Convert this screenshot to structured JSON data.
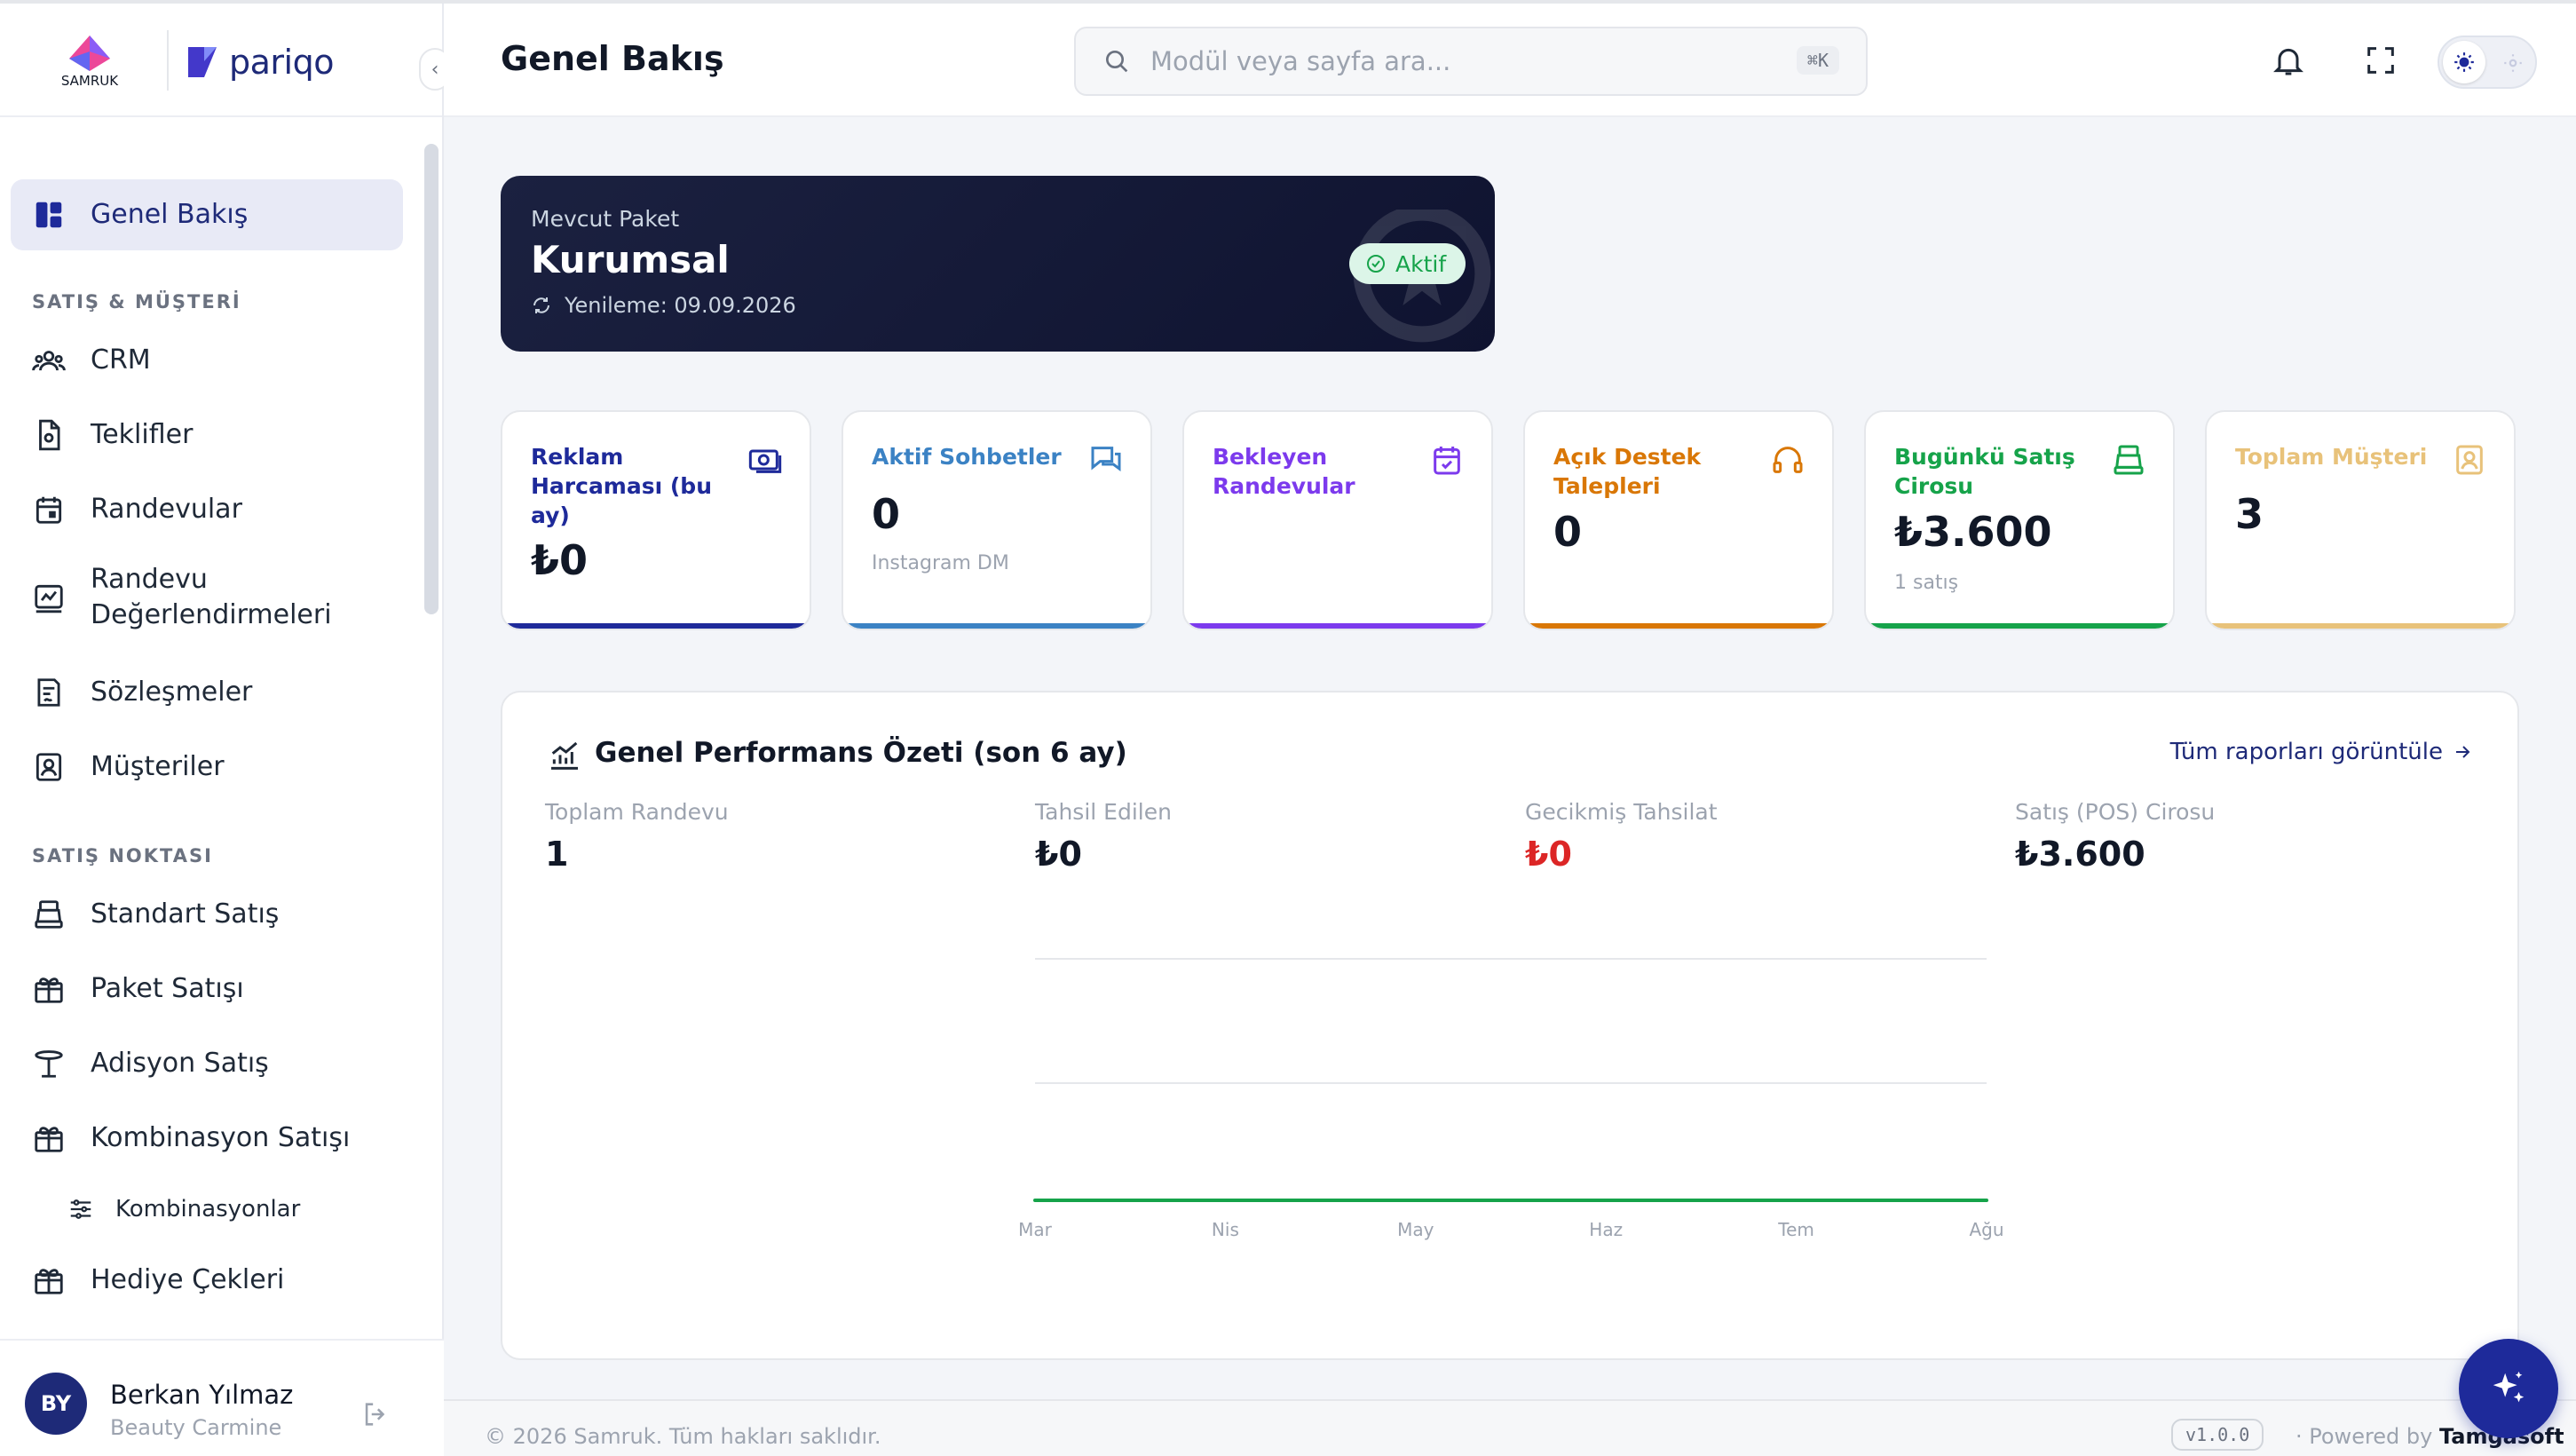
{
  "brand": {
    "left_logo_text": "SAMRUK",
    "right_logo_text": "pariqo"
  },
  "header": {
    "title": "Genel Bakış",
    "search_placeholder": "Modül veya sayfa ara...",
    "search_shortcut": "⌘K"
  },
  "sidebar": {
    "active": "Genel Bakış",
    "sections": [
      {
        "label": "",
        "items": [
          "Genel Bakış"
        ]
      },
      {
        "label": "SATIŞ & MÜŞTERİ",
        "items": [
          "CRM",
          "Teklifler",
          "Randevular",
          "Randevu Değerlendirmeleri",
          "Sözleşmeler",
          "Müşteriler"
        ]
      },
      {
        "label": "SATIŞ NOKTASI",
        "items": [
          "Standart Satış",
          "Paket Satışı",
          "Adisyon Satış",
          "Kombinasyon Satışı"
        ],
        "subitems": [
          "Kombinasyonlar"
        ],
        "more": [
          "Hediye Çekleri"
        ]
      }
    ],
    "labels": {
      "overview": "Genel Bakış",
      "sec_sales": "SATIŞ & MÜŞTERİ",
      "crm": "CRM",
      "offers": "Teklifler",
      "appointments": "Randevular",
      "reviews": "Randevu Değerlendirmeleri",
      "contracts": "Sözleşmeler",
      "customers": "Müşteriler",
      "sec_pos": "SATIŞ NOKTASI",
      "standard_sale": "Standart Satış",
      "package_sale": "Paket Satışı",
      "adisyon_sale": "Adisyon Satış",
      "combo_sale": "Kombinasyon Satışı",
      "combos": "Kombinasyonlar",
      "gift_cards": "Hediye Çekleri"
    }
  },
  "user": {
    "initials": "BY",
    "name": "Berkan Yılmaz",
    "org": "Beauty Carmine"
  },
  "package": {
    "label": "Mevcut Paket",
    "name": "Kurumsal",
    "renewal": "Yenileme: 09.09.2026",
    "status": "Aktif"
  },
  "stats": [
    {
      "title": "Reklam Harcaması (bu ay)",
      "value": "₺0",
      "sub": "",
      "color": "#1e2a9a"
    },
    {
      "title": "Aktif Sohbetler",
      "value": "0",
      "sub": "Instagram DM",
      "color": "#3b82c4"
    },
    {
      "title": "Bekleyen Randevular",
      "value": "",
      "sub": "",
      "color": "#7c3aed"
    },
    {
      "title": "Açık Destek Talepleri",
      "value": "0",
      "sub": "",
      "color": "#d97706"
    },
    {
      "title": "Bugünkü Satış Cirosu",
      "value": "₺3.600",
      "sub": "1 satış",
      "color": "#16a34a"
    },
    {
      "title": "Toplam Müşteri",
      "value": "3",
      "sub": "",
      "color": "#e8c27a"
    }
  ],
  "performance": {
    "title": "Genel Performans Özeti (son 6 ay)",
    "link": "Tüm raporları görüntüle",
    "kpis": [
      {
        "label": "Toplam Randevu",
        "value": "1"
      },
      {
        "label": "Tahsil Edilen",
        "value": "₺0"
      },
      {
        "label": "Gecikmiş Tahsilat",
        "value": "₺0"
      },
      {
        "label": "Satış (POS) Cirosu",
        "value": "₺3.600"
      }
    ]
  },
  "chart_data": {
    "type": "line",
    "categories": [
      "Mar",
      "Nis",
      "May",
      "Haz",
      "Tem",
      "Ağu"
    ],
    "series": [
      {
        "values": [
          0,
          0,
          0,
          0,
          0,
          0
        ],
        "color": "#16a34a"
      }
    ],
    "title": "",
    "xlabel": "",
    "ylabel": "",
    "grid": true
  },
  "footer": {
    "copyright": "© 2026 Samruk. Tüm hakları saklıdır.",
    "version": "v1.0.0",
    "powered_prefix": "· Powered by",
    "powered_brand": "Tamgasoft"
  }
}
